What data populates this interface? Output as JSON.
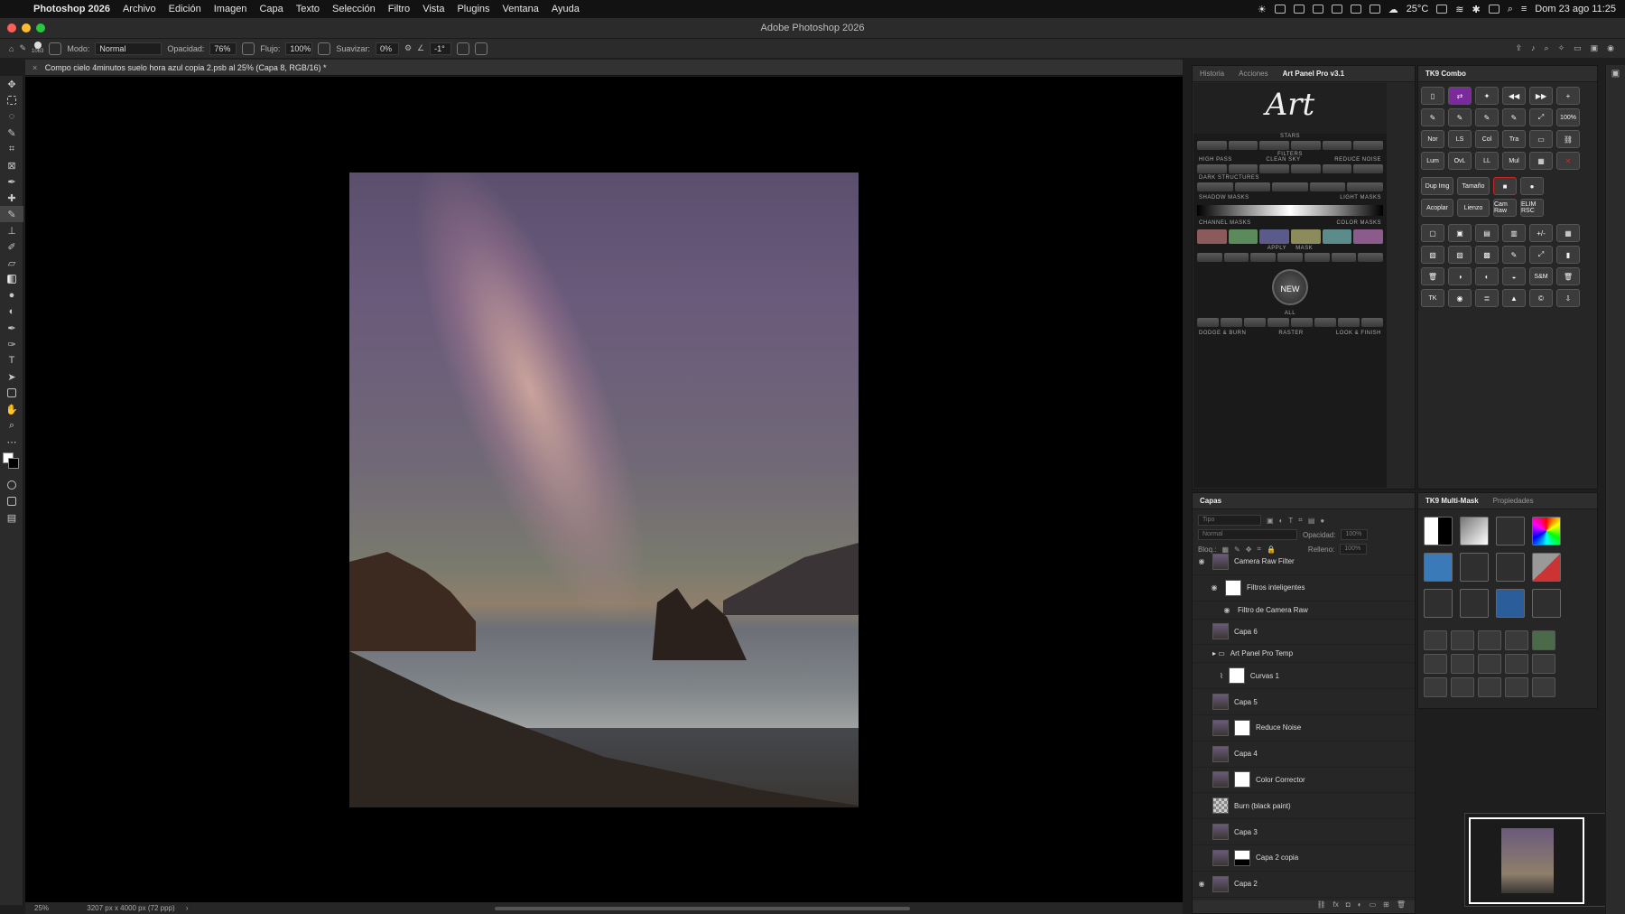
{
  "menubar": {
    "app_name": "Photoshop 2026",
    "items": [
      "Archivo",
      "Edición",
      "Imagen",
      "Capa",
      "Texto",
      "Selección",
      "Filtro",
      "Vista",
      "Plugins",
      "Ventana",
      "Ayuda"
    ],
    "temperature": "25°C",
    "datetime": "Dom 23 ago 11:25"
  },
  "window": {
    "title": "Adobe Photoshop 2026"
  },
  "options": {
    "brush_size": "1063",
    "mode_label": "Modo:",
    "mode_value": "Normal",
    "opacity_label": "Opacidad:",
    "opacity_value": "76%",
    "flow_label": "Flujo:",
    "flow_value": "100%",
    "smooth_label": "Suavizar:",
    "smooth_value": "0%",
    "angle_value": "-1°"
  },
  "document": {
    "tab_title": "Compo cielo 4minutos suelo hora azul copia 2.psb al 25% (Capa 8, RGB/16) *",
    "zoom": "25%",
    "dimensions": "3207 px x 4000 px (72 ppp)"
  },
  "artpanel": {
    "tabs": [
      "Historia",
      "Acciones",
      "Art Panel Pro v3.1"
    ],
    "logo": "Art",
    "labels": {
      "stars": "STARS",
      "filters": "FILTERS",
      "high_pass": "HIGH PASS",
      "clean_sky": "CLEAN SKY",
      "reduce_noise": "REDUCE NOISE",
      "dark_structures": "DARK STRUCTURES",
      "shadow_masks": "SHADOW MASKS",
      "light_masks": "LIGHT MASKS",
      "channel_masks": "CHANNEL MASKS",
      "color_masks": "COLOR MASKS",
      "apply": "APPLY",
      "mask": "MASK",
      "new": "NEW",
      "all": "ALL",
      "dodge_burn": "DODGE & BURN",
      "raster": "RASTER",
      "look_finish": "LOOK & FINISH"
    }
  },
  "tk9combo": {
    "title": "TK9 Combo",
    "buttons": [
      "Nor",
      "LS",
      "Col",
      "Tra",
      "Lum",
      "OvL",
      "LL",
      "Mul",
      "Dup Img",
      "Tamaño",
      "Acoplar",
      "Lienzo",
      "Cam Raw",
      "ELIM RSC",
      "100%",
      "S&M",
      "TK"
    ]
  },
  "layers_panel": {
    "title": "Capas",
    "filter_label": "Tipo",
    "blend_mode": "Normal",
    "opacity_label": "Opacidad:",
    "opacity_value": "100%",
    "lock_label": "Bloq.:",
    "fill_label": "Relleno:",
    "fill_value": "100%",
    "layers": [
      {
        "name": "Camera Raw Filter",
        "visible": true,
        "type": "smart"
      },
      {
        "name": "Filtros inteligentes",
        "visible": true,
        "type": "smart-filters"
      },
      {
        "name": "Filtro de Camera Raw",
        "visible": true,
        "type": "filter"
      },
      {
        "name": "Capa 6",
        "visible": false,
        "type": "pixel"
      },
      {
        "name": "Art Panel Pro Temp",
        "visible": false,
        "type": "group"
      },
      {
        "name": "Curvas 1",
        "visible": false,
        "type": "adjustment"
      },
      {
        "name": "Capa 5",
        "visible": false,
        "type": "pixel"
      },
      {
        "name": "Reduce Noise",
        "visible": false,
        "type": "masked"
      },
      {
        "name": "Capa 4",
        "visible": false,
        "type": "pixel"
      },
      {
        "name": "Color Corrector",
        "visible": false,
        "type": "masked"
      },
      {
        "name": "Burn (black paint)",
        "visible": false,
        "type": "transparent"
      },
      {
        "name": "Capa 3",
        "visible": false,
        "type": "pixel"
      },
      {
        "name": "Capa 2 copia",
        "visible": false,
        "type": "masked"
      },
      {
        "name": "Capa 2",
        "visible": true,
        "type": "pixel"
      }
    ]
  },
  "multimask": {
    "tabs": [
      "TK9 Multi-Mask",
      "Propiedades"
    ]
  }
}
